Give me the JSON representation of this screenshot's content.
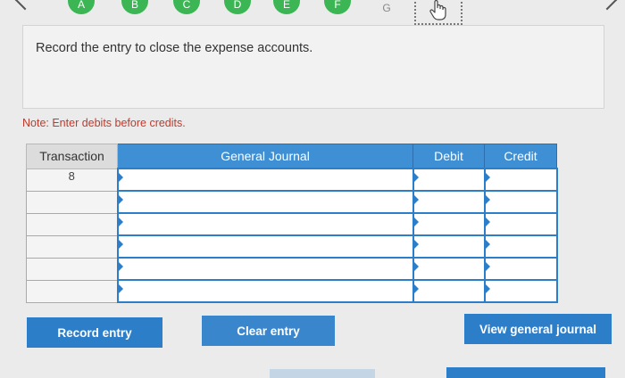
{
  "steps": [
    {
      "label": "A",
      "active": true
    },
    {
      "label": "B",
      "active": true
    },
    {
      "label": "C",
      "active": true
    },
    {
      "label": "D",
      "active": true
    },
    {
      "label": "E",
      "active": true
    },
    {
      "label": "F",
      "active": true
    },
    {
      "label": "G",
      "active": false
    }
  ],
  "prompt": {
    "text": "Record the entry to close the expense accounts."
  },
  "note": "Note: Enter debits before credits.",
  "table": {
    "headers": {
      "transaction": "Transaction",
      "journal": "General Journal",
      "debit": "Debit",
      "credit": "Credit"
    },
    "rows": [
      {
        "transaction": "8"
      },
      {
        "transaction": ""
      },
      {
        "transaction": ""
      },
      {
        "transaction": ""
      },
      {
        "transaction": ""
      },
      {
        "transaction": ""
      }
    ]
  },
  "buttons": {
    "record": "Record entry",
    "clear": "Clear entry",
    "view": "View general journal"
  },
  "icons": {
    "back": "chevron-left-icon",
    "forward": "chevron-right-icon",
    "cursor": "hand-cursor-icon"
  },
  "colors": {
    "accent": "#2c7ec9",
    "step_complete": "#3cb554",
    "header": "#3e8fd3",
    "note": "#c0392b"
  }
}
